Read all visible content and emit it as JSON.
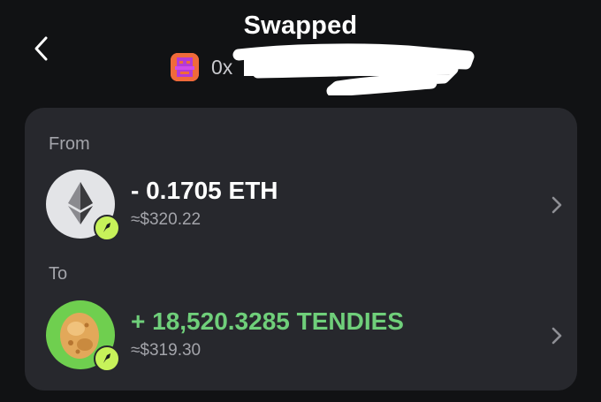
{
  "header": {
    "title": "Swapped",
    "address_visible": "0x",
    "back_icon": "chevron-left-icon"
  },
  "from": {
    "label": "From",
    "amount": "- 0.1705 ETH",
    "fiat": "≈$320.22",
    "token_icon": "ethereum-icon",
    "amount_color": "#ffffff"
  },
  "to": {
    "label": "To",
    "amount": "+ 18,520.3285 TENDIES",
    "fiat": "≈$319.30",
    "token_icon": "chicken-nugget-icon",
    "amount_color": "#6fcf7a"
  },
  "colors": {
    "background": "#111214",
    "card": "#27282d",
    "positive": "#6fcf7a",
    "badge": "#c7f25a",
    "muted": "#a3a4aa"
  }
}
